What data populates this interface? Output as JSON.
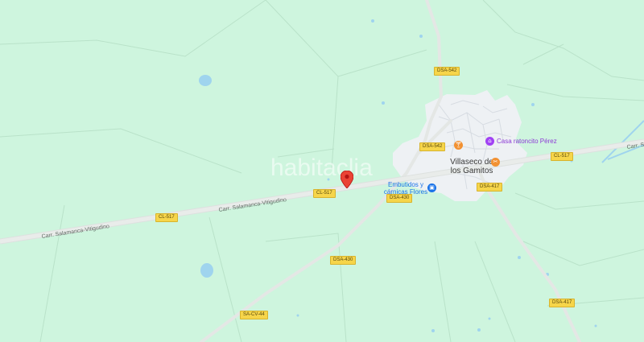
{
  "map": {
    "watermark": "habitaclia",
    "town": {
      "line1": "Villaseco de",
      "line2": "los Gamitos"
    },
    "road_names": {
      "main_left": "Carr. Salamanca-Vitigudino",
      "main_mid": "Carr. Salamanca-Vitigudino",
      "main_right": "Carr. Sala"
    },
    "shields": {
      "dsa542_top": "DSA-542",
      "dsa542_town": "DSA-542",
      "cl517_right": "CL-517",
      "cl517_mid": "CL-517",
      "cl517_left": "CL-517",
      "dsa417_town": "DSA-417",
      "dsa430_town": "DSA-430",
      "dsa430_south": "DSA-430",
      "sacv44": "SA-CV-44",
      "dsa417_south": "DSA-417"
    },
    "pois": {
      "casa_raton": {
        "label": "Casa ratoncito Pérez",
        "icon": "museum-icon",
        "color": "#a142f4"
      },
      "butcher": {
        "line1": "Embutidos y",
        "line2": "cárnicas Flores",
        "icon": "shopping-bag-icon",
        "color": "#1a73e8"
      },
      "bar_icon": {
        "icon": "cocktail-icon",
        "color": "#f29132"
      },
      "restaurant_icon": {
        "icon": "fork-knife-icon",
        "color": "#f29132"
      }
    },
    "marker": {
      "icon": "location-pin-icon",
      "color": "#ea4335"
    },
    "colors": {
      "land": "#cef5de",
      "road": "#e4e7e5",
      "water": "#9fd4ee",
      "urban": "#eef1f4"
    }
  }
}
